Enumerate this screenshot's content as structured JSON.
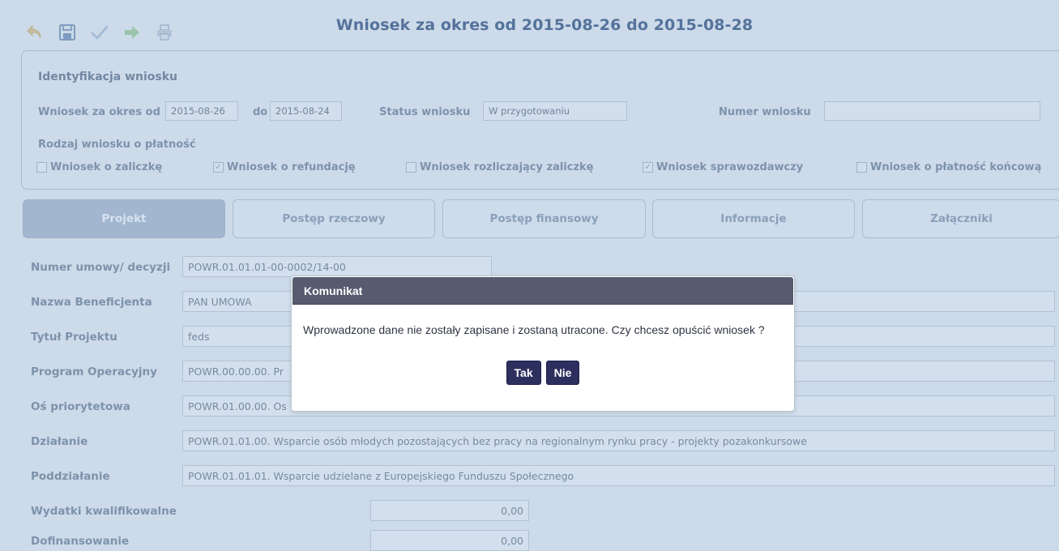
{
  "toolbar": {
    "icons": [
      "undo-icon",
      "save-icon",
      "validate-icon",
      "forward-icon",
      "print-icon"
    ]
  },
  "page": {
    "title": "Wniosek za okres od 2015-08-26 do 2015-08-28"
  },
  "identification": {
    "title": "Identyfikacja wniosku",
    "period_label": "Wniosek za okres od",
    "period_from": "2015-08-26",
    "period_to_label": "do",
    "period_to": "2015-08-24",
    "status_label": "Status wniosku",
    "status_value": "W przygotowaniu",
    "number_label": "Numer wniosku",
    "number_value": "",
    "payment_type_label": "Rodzaj wniosku o płatność",
    "checkboxes": [
      {
        "label": "Wniosek o zaliczkę",
        "checked": false
      },
      {
        "label": "Wniosek o refundację",
        "checked": true
      },
      {
        "label": "Wniosek rozliczający zaliczkę",
        "checked": false
      },
      {
        "label": "Wniosek sprawozdawczy",
        "checked": true
      },
      {
        "label": "Wniosek o płatność końcową",
        "checked": false
      }
    ]
  },
  "tabs": [
    {
      "label": "Projekt",
      "active": true
    },
    {
      "label": "Postęp rzeczowy",
      "active": false
    },
    {
      "label": "Postęp finansowy",
      "active": false
    },
    {
      "label": "Informacje",
      "active": false
    },
    {
      "label": "Załączniki",
      "active": false
    }
  ],
  "project": {
    "rows": [
      {
        "label": "Numer umowy/ decyzji",
        "value": "POWR.01.01.01-00-0002/14-00"
      },
      {
        "label": "Nazwa Beneficjenta",
        "value": "PAN UMOWA"
      },
      {
        "label": "Tytuł Projektu",
        "value": "feds"
      },
      {
        "label": "Program Operacyjny",
        "value": "POWR.00.00.00. Pr"
      },
      {
        "label": "Oś priorytetowa",
        "value": "POWR.01.00.00. Os"
      },
      {
        "label": "Działanie",
        "value": "POWR.01.01.00. Wsparcie osób młodych pozostających bez pracy na regionalnym rynku pracy - projekty pozakonkursowe"
      },
      {
        "label": "Poddziałanie",
        "value": "POWR.01.01.01. Wsparcie udzielane z Europejskiego Funduszu Społecznego"
      },
      {
        "label": "Wydatki kwalifikowalne",
        "value": "0,00"
      },
      {
        "label": "Dofinansowanie",
        "value": "0,00"
      }
    ]
  },
  "dialog": {
    "title": "Komunikat",
    "message": "Wprowadzone dane nie zostały zapisane i zostaną utracone. Czy chcesz opuścić wniosek ?",
    "yes_label": "Tak",
    "no_label": "Nie"
  },
  "colors": {
    "title": "#2c4b78",
    "dialog_header": "#575b6e",
    "dialog_button": "#2d2f5e",
    "active_tab": "#aab9cc"
  }
}
